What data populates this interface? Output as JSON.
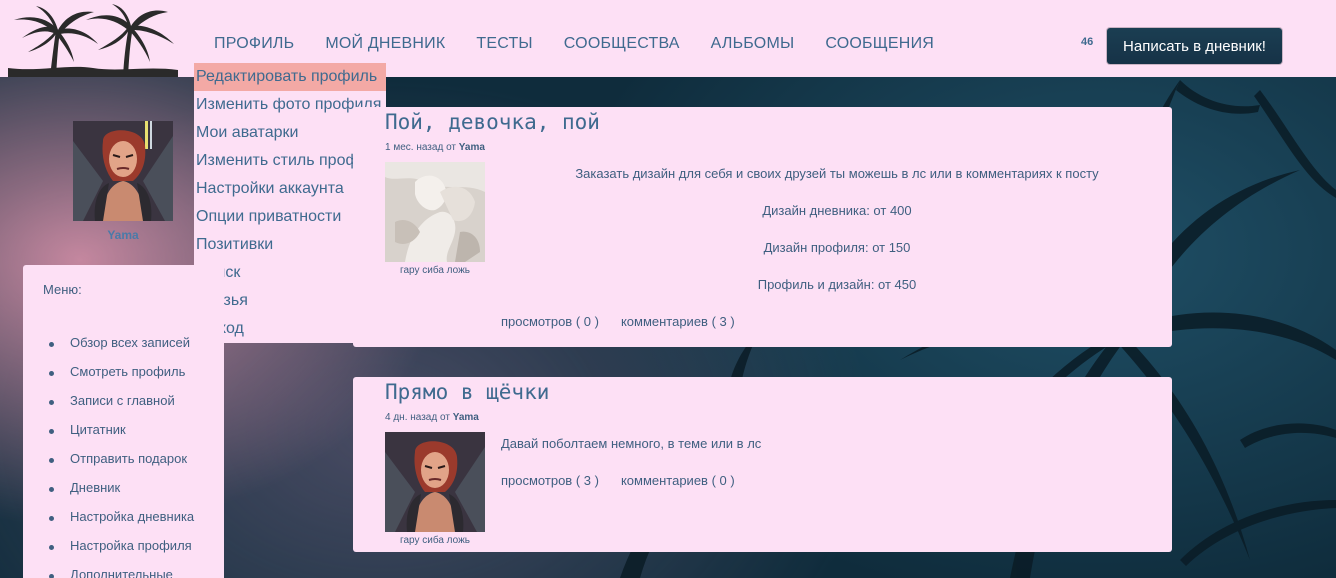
{
  "header": {
    "nav": [
      "ПРОФИЛЬ",
      "МОЙ ДНЕВНИК",
      "ТЕСТЫ",
      "СООБЩЕСТВА",
      "АЛЬБОМЫ",
      "СООБЩЕНИЯ"
    ],
    "counter": "46",
    "write_button": "Написать в дневник!"
  },
  "dropdown": {
    "items": [
      "Редактировать профиль",
      "Изменить фото профиля",
      "Мои аватарки",
      "Изменить стиль профиля",
      "Настройки аккаунта",
      "Опции приватности",
      "Позитивки",
      "Поиск",
      "Друзья",
      "Выход"
    ]
  },
  "sidebar": {
    "username": "Yama",
    "menu_title": "Меню:",
    "menu_items": [
      "Обзор всех записей",
      "Смотреть профиль",
      "Записи с главной",
      "Цитатник",
      "Отправить подарок",
      "Дневник",
      "Настройка дневника",
      "Настройка профиля",
      "Дополнительные"
    ]
  },
  "posts": [
    {
      "title": "Пой, девочка, пой",
      "meta_time": "1 мес. назад от",
      "meta_author": "Yama",
      "thumb_caption": "гару сиба ложь",
      "lines": [
        "Заказать дизайн для себя и своих друзей ты можешь в лс или в комментариях к посту",
        "Дизайн дневника: от 400",
        "Дизайн профиля: от 150",
        "Профиль и дизайн: от 450"
      ],
      "views": "просмотров ( 0 )",
      "comments": "комментариев ( 3 )"
    },
    {
      "title": "Прямо в щёчки",
      "meta_time": "4 дн. назад от",
      "meta_author": "Yama",
      "thumb_caption": "гару сиба ложь",
      "text": "Давай поболтаем немного, в теме или в лс",
      "views": "просмотров ( 3 )",
      "comments": "комментариев ( 0 )"
    }
  ],
  "colors": {
    "panel_bg": "#fde0f5",
    "link_text": "#3f6a8f",
    "active_menu": "#f3a9a5",
    "button_bg": "#1b3e52"
  }
}
